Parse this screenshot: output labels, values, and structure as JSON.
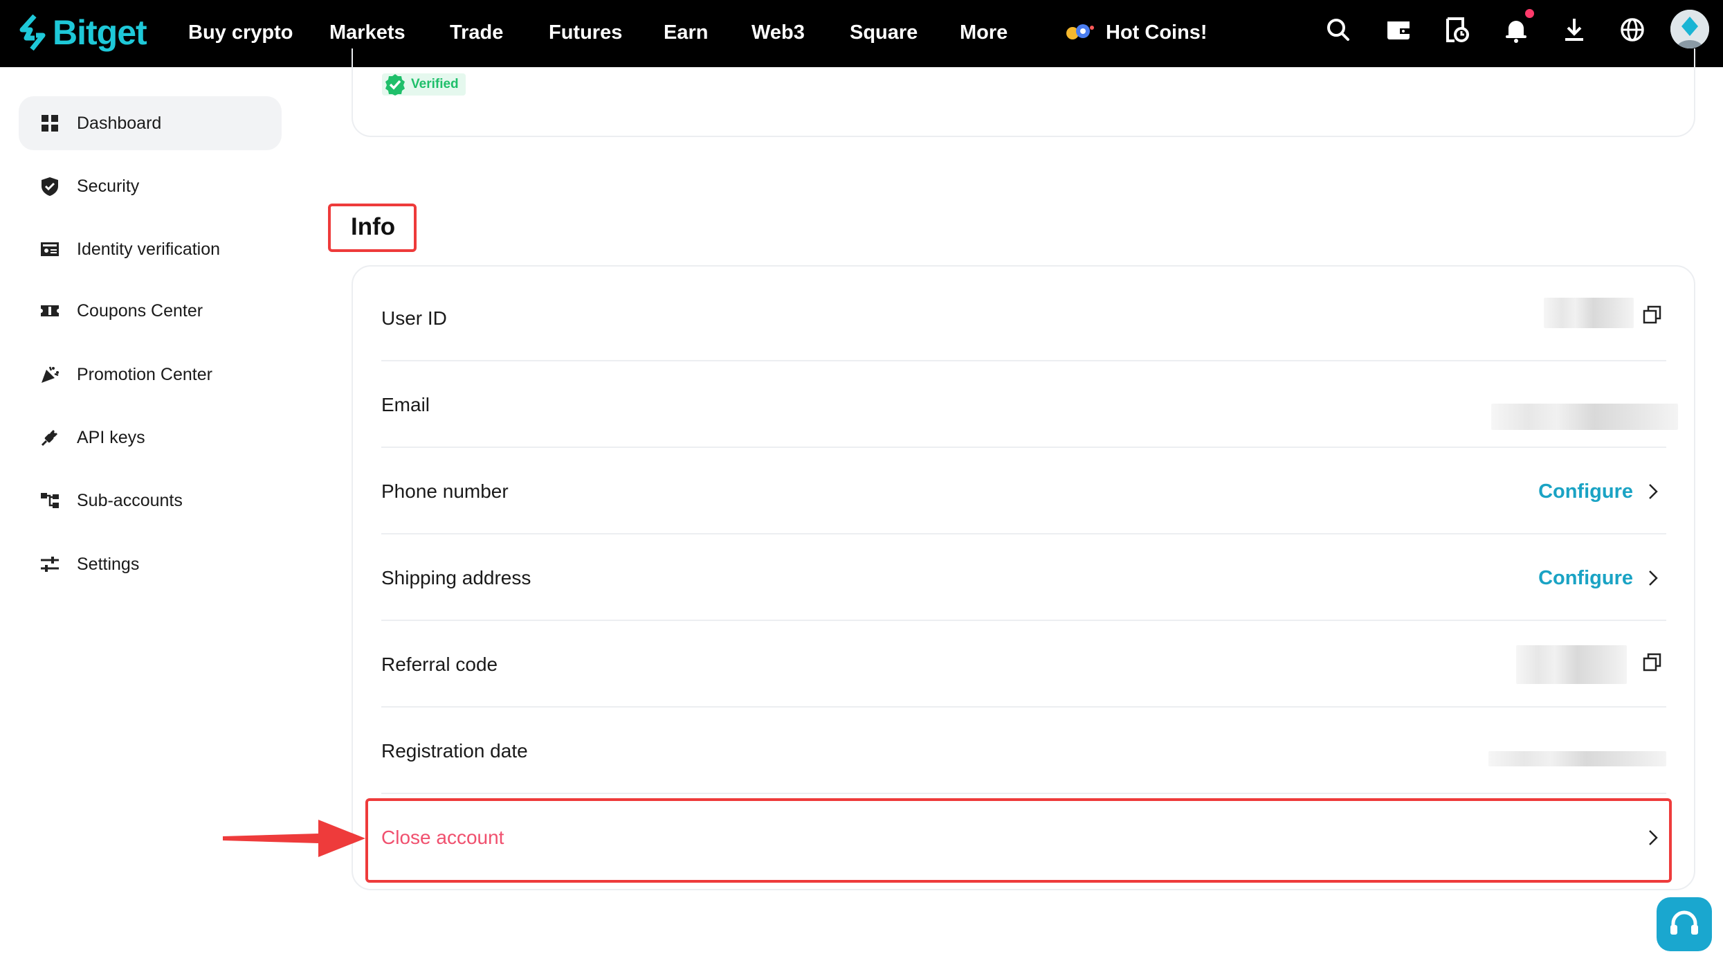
{
  "brand": {
    "name": "Bitget",
    "accent": "#1ec8d8"
  },
  "nav": {
    "items": [
      "Buy crypto",
      "Markets",
      "Trade",
      "Futures",
      "Earn",
      "Web3",
      "Square",
      "More"
    ],
    "hot_label": "Hot Coins!",
    "icons": [
      "search-icon",
      "wallet-icon",
      "orders-icon",
      "notification-icon",
      "download-icon",
      "globe-icon",
      "avatar"
    ]
  },
  "sidebar": {
    "items": [
      {
        "label": "Dashboard",
        "icon": "dashboard-icon",
        "active": true
      },
      {
        "label": "Security",
        "icon": "shield-icon",
        "active": false
      },
      {
        "label": "Identity verification",
        "icon": "id-card-icon",
        "active": false
      },
      {
        "label": "Coupons Center",
        "icon": "coupon-icon",
        "active": false
      },
      {
        "label": "Promotion Center",
        "icon": "party-popper-icon",
        "active": false
      },
      {
        "label": "API keys",
        "icon": "plug-icon",
        "active": false
      },
      {
        "label": "Sub-accounts",
        "icon": "hierarchy-icon",
        "active": false
      },
      {
        "label": "Settings",
        "icon": "sliders-icon",
        "active": false
      }
    ]
  },
  "profile": {
    "verified_label": "Verified"
  },
  "info": {
    "title": "Info",
    "rows": {
      "user_id": {
        "label": "User ID"
      },
      "email": {
        "label": "Email"
      },
      "phone": {
        "label": "Phone number",
        "action": "Configure"
      },
      "shipping": {
        "label": "Shipping address",
        "action": "Configure"
      },
      "referral": {
        "label": "Referral code"
      },
      "registration": {
        "label": "Registration date"
      },
      "close": {
        "label": "Close account"
      }
    }
  },
  "colors": {
    "link": "#1aa3c4",
    "danger": "#f0506e",
    "highlight": "#ee3b3b",
    "verified": "#1fbf6a"
  }
}
